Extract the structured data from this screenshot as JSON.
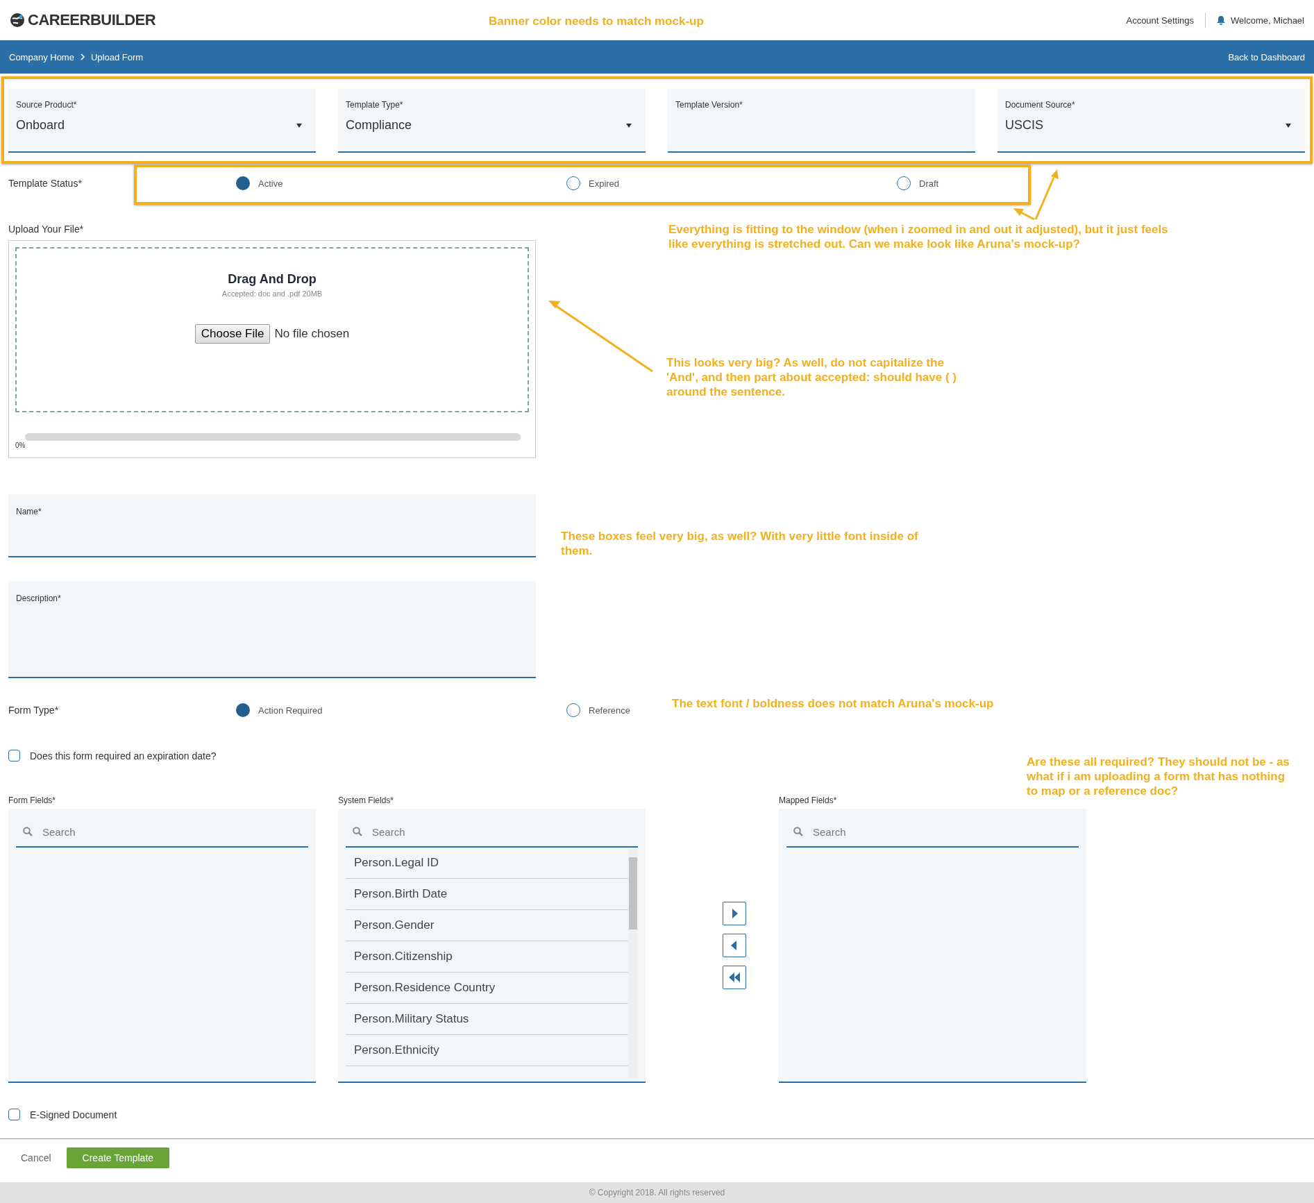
{
  "header": {
    "logo": "CAREERBUILDER",
    "links": [
      {
        "label": "Account Settings"
      },
      {
        "label": "Welcome, Michael"
      }
    ]
  },
  "breadcrumb": [
    {
      "label": "Company Home"
    },
    {
      "label": "Upload Form"
    }
  ],
  "back_link": "Back to Dashboard",
  "top_fields": [
    {
      "kind": "select",
      "label": "Source Product*",
      "value": "Onboard"
    },
    {
      "kind": "select",
      "label": "Template Type*",
      "value": "Compliance"
    },
    {
      "kind": "text",
      "label": "Template Version*"
    },
    {
      "kind": "select",
      "label": "Document Source*",
      "value": "USCIS"
    }
  ],
  "template_status": {
    "label": "Template Status*",
    "options": [
      {
        "label": "Active",
        "selected": true
      },
      {
        "label": "Expired",
        "selected": false
      },
      {
        "label": "Draft",
        "selected": false
      }
    ]
  },
  "upload": {
    "label": "Upload Your File*",
    "title": "Drag And Drop",
    "hint": "Accepted: doc and .pdf 20MB",
    "button": "Choose File",
    "file_status": "No file chosen",
    "level": 0,
    "reading": "0%"
  },
  "name_field": {
    "label": "Name*"
  },
  "description_field": {
    "label": "Description*"
  },
  "form_type": {
    "label": "Form Type*",
    "options": [
      {
        "label": "Action Required",
        "selected": true
      },
      {
        "label": "Reference",
        "selected": false
      }
    ]
  },
  "expiration_checkbox": {
    "label": "Does this form required an expiration date?",
    "checked": false
  },
  "lists": [
    {
      "label": "Form Fields*",
      "placeholder": "Search"
    },
    {
      "label": "System Fields*",
      "placeholder": "Search",
      "items": [
        "Person.Legal ID",
        "Person.Birth Date",
        "Person.Gender",
        "Person.Citizenship",
        "Person.Residence Country",
        "Person.Military Status",
        "Person.Ethnicity"
      ]
    },
    {
      "label": "Mapped Fields*",
      "placeholder": "Search"
    }
  ],
  "esigned_checkbox": {
    "label": "E-Signed Document",
    "checked": false
  },
  "actions": {
    "cancel": "Cancel",
    "create": "Create Template"
  },
  "footer": "© Copyright 2018. All rights reserved",
  "annotations": [
    {
      "text": "Banner color needs to match mock-up"
    },
    {
      "text": "Everything is fitting to the window (when i zoomed in and out it adjusted), but it just feels like everything is stretched out.  Can we make look like Aruna's mock-up?"
    },
    {
      "text": "This looks very big?  As well, do not capitalize the 'And', and then part about accepted: should have ( ) around the sentence."
    },
    {
      "text": "These boxes feel very big, as well?  With very little font inside of them."
    },
    {
      "text": "The text font / boldness does not match Aruna's mock-up"
    },
    {
      "text": "Are these all required?  They should not be - as what if i am uploading a form that has nothing to map or a reference doc?"
    }
  ]
}
